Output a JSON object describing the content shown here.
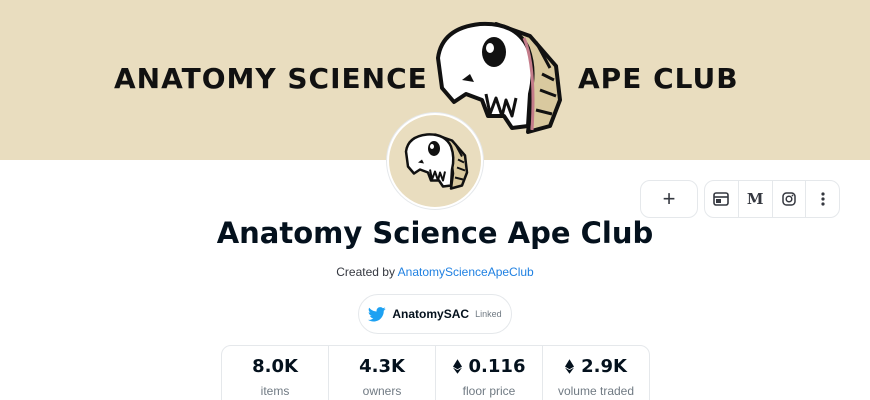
{
  "banner": {
    "text_left": "ANATOMY SCIENCE",
    "text_right": "APE CLUB",
    "logo_icon": "ape-skull-icon",
    "background_color": "#e9ddbf"
  },
  "avatar": {
    "icon": "ape-skull-icon"
  },
  "actions": {
    "add_label": "+",
    "website_icon": "website-icon",
    "medium_label": "M",
    "instagram_icon": "instagram-icon",
    "more_icon": "more-vertical-icon"
  },
  "collection": {
    "title": "Anatomy Science Ape Club",
    "created_by_label": "Created by",
    "creator": "AnatomyScienceApeClub"
  },
  "twitter": {
    "icon": "twitter-icon",
    "handle": "AnatomySAC",
    "status": "Linked"
  },
  "stats": [
    {
      "value": "8.0K",
      "label": "items",
      "currency_icon": false
    },
    {
      "value": "4.3K",
      "label": "owners",
      "currency_icon": false
    },
    {
      "value": "0.116",
      "label": "floor price",
      "currency_icon": true
    },
    {
      "value": "2.9K",
      "label": "volume traded",
      "currency_icon": true
    }
  ],
  "colors": {
    "link": "#2081e2",
    "twitter": "#1da1f2",
    "text": "#04111d",
    "muted": "#707a83"
  }
}
